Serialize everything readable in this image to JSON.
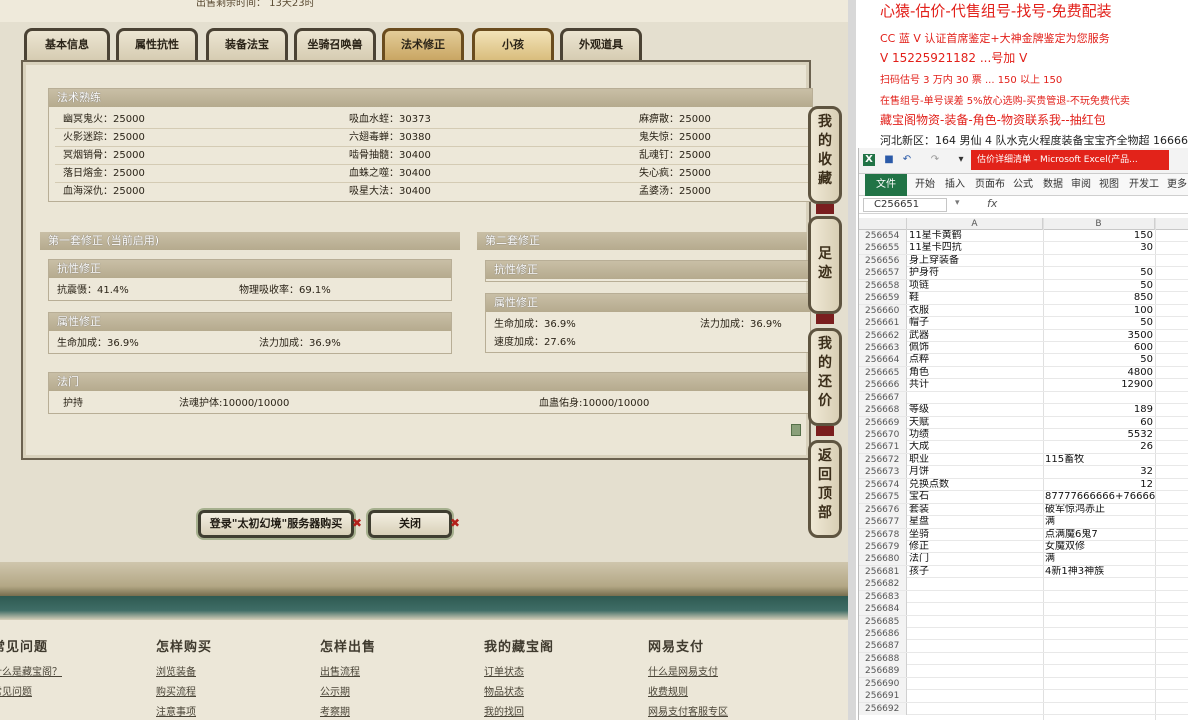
{
  "game": {
    "top_text": "出售剩余时间：  13天23时",
    "tabs": [
      "基本信息",
      "属性抗性",
      "装备法宝",
      "坐骑召唤兽",
      "法术修正",
      "小孩",
      "外观道具"
    ],
    "skills_section": {
      "title": "法术熟练",
      "rows": [
        [
          "幽冥鬼火：25000",
          "吸血水蛭：30373",
          "麻痹散：25000"
        ],
        [
          "火影迷踪：25000",
          "六翅毒蝉：30380",
          "鬼失惊：25000"
        ],
        [
          "冥烟销骨：25000",
          "啮骨抽髓：30400",
          "乱魂钉：25000"
        ],
        [
          "落日熔金：25000",
          "血蛛之噬：30400",
          "失心疯：25000"
        ],
        [
          "血海深仇：25000",
          "吸星大法：30400",
          "孟婆汤：25000"
        ]
      ]
    },
    "set1": {
      "title": "第一套修正 (当前启用)",
      "resist_title": "抗性修正",
      "resist_items": [
        "抗震慑：41.4%",
        "物理吸收率：69.1%"
      ],
      "attr_title": "属性修正",
      "attr_items": [
        "生命加成：36.9%",
        "法力加成：36.9%"
      ]
    },
    "set2": {
      "title": "第二套修正",
      "resist_title": "抗性修正",
      "attr_title": "属性修正",
      "attr_items": [
        "生命加成：36.9%",
        "法力加成：36.9%",
        "速度加成：27.6%"
      ]
    },
    "fa_men": {
      "title": "法门",
      "items": [
        "护持",
        "法魂护体:10000/10000",
        "血蛊佑身:10000/10000"
      ]
    },
    "side_buttons": [
      [
        "我",
        "的",
        "收",
        "藏"
      ],
      [
        "足",
        "迹"
      ],
      [
        "我",
        "的",
        "还",
        "价"
      ],
      [
        "返",
        "回",
        "顶",
        "部"
      ]
    ],
    "buy_button": "登录\"太初幻境\"服务器购买",
    "close_button": "关闭",
    "footer": [
      {
        "title": "常见问题",
        "links": [
          "什么是藏宝阁？",
          "常见问题"
        ]
      },
      {
        "title": "怎样购买",
        "links": [
          "浏览装备",
          "购买流程",
          "注意事项"
        ]
      },
      {
        "title": "怎样出售",
        "links": [
          "出售流程",
          "公示期",
          "考察期"
        ]
      },
      {
        "title": "我的藏宝阁",
        "links": [
          "订单状态",
          "物品状态",
          "我的找回"
        ]
      },
      {
        "title": "网易支付",
        "links": [
          "什么是网易支付",
          "收费规则",
          "网易支付客服专区"
        ]
      }
    ]
  },
  "promo": {
    "line1": "心猿-估价-代售组号-找号-免费配装",
    "line2": "CC 蓝 V 认证首席鉴定+大神金牌鉴定为您服务",
    "line3": "V 15225921182      ...号加 V",
    "line4": "扫码估号 3 万内 30 票 ... 150 以上 150",
    "line5": "在售组号-单号误差 5%放心选购-买贵管退-不玩免费代卖",
    "line6": "藏宝阁物资-装备-角色-物资联系我--抽红包",
    "line7": "河北新区：164 男仙 4 队水克火程度装备宝宝齐全物超 16666"
  },
  "excel": {
    "doc_title": "估价详细清单 - Microsoft Excel(产品...",
    "file_tab": "文件",
    "ribbon_tabs": [
      "开始",
      "插入",
      "页面布",
      "公式",
      "数据",
      "审阅",
      "视图",
      "开发工",
      "更多"
    ],
    "name_box": "C256651",
    "fx": "fx",
    "col_a": "A",
    "col_b": "B",
    "rows": [
      {
        "n": "256654",
        "a": "11星卡黄鹤",
        "b": "150",
        "t": "num"
      },
      {
        "n": "256655",
        "a": "11星卡四抗",
        "b": "30",
        "t": "num"
      },
      {
        "n": "256656",
        "a": "身上穿装备",
        "b": "",
        "t": "num"
      },
      {
        "n": "256657",
        "a": "护身符",
        "b": "50",
        "t": "num"
      },
      {
        "n": "256658",
        "a": "项链",
        "b": "50",
        "t": "num"
      },
      {
        "n": "256659",
        "a": "鞋",
        "b": "850",
        "t": "num"
      },
      {
        "n": "256660",
        "a": "衣服",
        "b": "100",
        "t": "num"
      },
      {
        "n": "256661",
        "a": "帽子",
        "b": "50",
        "t": "num"
      },
      {
        "n": "256662",
        "a": "武器",
        "b": "3500",
        "t": "num"
      },
      {
        "n": "256663",
        "a": "佩饰",
        "b": "600",
        "t": "num"
      },
      {
        "n": "256664",
        "a": "点粹",
        "b": "50",
        "t": "num"
      },
      {
        "n": "256665",
        "a": "角色",
        "b": "4800",
        "t": "num"
      },
      {
        "n": "256666",
        "a": "共计",
        "b": "12900",
        "t": "num"
      },
      {
        "n": "256667",
        "a": "",
        "b": "",
        "t": "num"
      },
      {
        "n": "256668",
        "a": "等级",
        "b": "189",
        "t": "num"
      },
      {
        "n": "256669",
        "a": "天赋",
        "b": "60",
        "t": "num"
      },
      {
        "n": "256670",
        "a": "功绩",
        "b": "5532",
        "t": "num"
      },
      {
        "n": "256671",
        "a": "大成",
        "b": "26",
        "t": "num"
      },
      {
        "n": "256672",
        "a": "职业",
        "b": "115畜牧",
        "t": "txt"
      },
      {
        "n": "256673",
        "a": "月饼",
        "b": "32",
        "t": "num"
      },
      {
        "n": "256674",
        "a": "兑换点数",
        "b": "12",
        "t": "num"
      },
      {
        "n": "256675",
        "a": "宝石",
        "b": "87777666666+76666",
        "t": "txt"
      },
      {
        "n": "256676",
        "a": "套装",
        "b": "破军惊鸿赤止",
        "t": "txt"
      },
      {
        "n": "256677",
        "a": "星盘",
        "b": "满",
        "t": "txt"
      },
      {
        "n": "256678",
        "a": "坐骑",
        "b": "点满魔6鬼7",
        "t": "txt"
      },
      {
        "n": "256679",
        "a": "修正",
        "b": "女魔双修",
        "t": "txt"
      },
      {
        "n": "256680",
        "a": "法门",
        "b": "满",
        "t": "txt"
      },
      {
        "n": "256681",
        "a": "孩子",
        "b": "4新1神3神族",
        "t": "txt"
      },
      {
        "n": "256682",
        "a": "",
        "b": "",
        "t": "num"
      },
      {
        "n": "256683",
        "a": "",
        "b": "",
        "t": "num"
      },
      {
        "n": "256684",
        "a": "",
        "b": "",
        "t": "num"
      },
      {
        "n": "256685",
        "a": "",
        "b": "",
        "t": "num"
      },
      {
        "n": "256686",
        "a": "",
        "b": "",
        "t": "num"
      },
      {
        "n": "256687",
        "a": "",
        "b": "",
        "t": "num"
      },
      {
        "n": "256688",
        "a": "",
        "b": "",
        "t": "num"
      },
      {
        "n": "256689",
        "a": "",
        "b": "",
        "t": "num"
      },
      {
        "n": "256690",
        "a": "",
        "b": "",
        "t": "num"
      },
      {
        "n": "256691",
        "a": "",
        "b": "",
        "t": "num"
      },
      {
        "n": "256692",
        "a": "",
        "b": "",
        "t": "num"
      }
    ]
  }
}
